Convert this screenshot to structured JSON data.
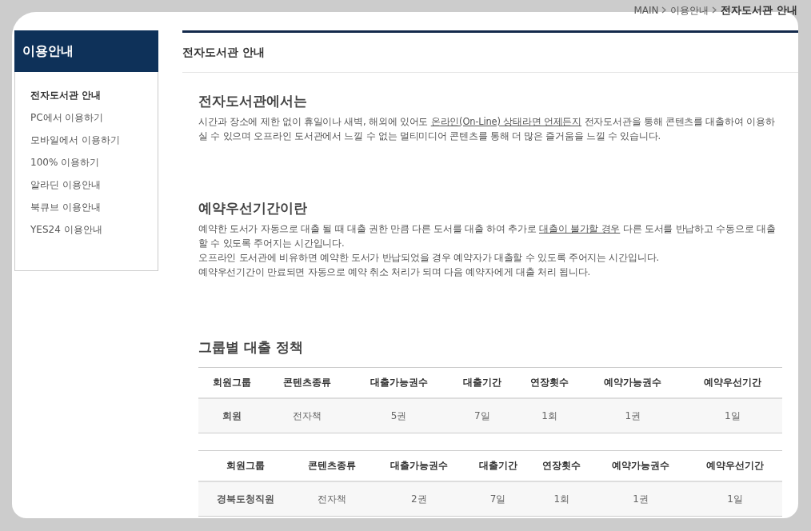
{
  "breadcrumb": {
    "items": [
      "MAIN",
      "이용안내"
    ],
    "current": "전자도서관 안내"
  },
  "sidebar": {
    "title": "이용안내",
    "items": [
      {
        "label": "전자도서관 안내",
        "selected": true
      },
      {
        "label": "PC에서 이용하기",
        "selected": false
      },
      {
        "label": "모바일에서 이용하기",
        "selected": false
      },
      {
        "label": "100% 이용하기",
        "selected": false
      },
      {
        "label": "알라딘 이용안내",
        "selected": false
      },
      {
        "label": "북큐브 이용안내",
        "selected": false
      },
      {
        "label": "YES24 이용안내",
        "selected": false
      }
    ]
  },
  "page_title": "전자도서관 안내",
  "sections": [
    {
      "heading": "전자도서관에서는",
      "paragraphs": [
        [
          {
            "kind": "text",
            "text": "시간과 장소에 제한 없이 휴일이나 새벽, 해외에 있어도 "
          },
          {
            "kind": "link",
            "text": "온라인(On-Line) 상태라면 언제든지"
          },
          {
            "kind": "text",
            "text": " 전자도서관을 통해 콘텐츠를 대출하여 이용하실 수 있으며 오프라인 도서관에서 느낄 수 없는 멀티미디어 콘텐츠를 통해 더 많은 즐거움을 느낄 수 있습니다."
          }
        ]
      ]
    },
    {
      "heading": "예약우선기간이란",
      "paragraphs": [
        [
          {
            "kind": "text",
            "text": "예약한 도서가 자동으로 대출 될 때 대출 권한 만큼 다른 도서를 대출 하여 추가로 "
          },
          {
            "kind": "link",
            "text": "대출이 불가할 경우"
          },
          {
            "kind": "text",
            "text": " 다른 도서를 반납하고 수동으로 대출 할 수 있도록 주어지는 시간입니다."
          }
        ],
        [
          {
            "kind": "text",
            "text": "오프라인 도서관에 비유하면 예약한 도서가 반납되었을 경우 예약자가 대출할 수 있도록 주어지는 시간입니다."
          }
        ],
        [
          {
            "kind": "text",
            "text": "예약우선기간이 만료되면 자동으로 예약 취소 처리가 되며 다음 예약자에게 대출 처리 됩니다."
          }
        ]
      ]
    },
    {
      "heading": "그룹별 대출 정책",
      "tables": [
        {
          "columns": [
            "회원그룹",
            "콘텐츠종류",
            "대출가능권수",
            "대출기간",
            "연장횟수",
            "예약가능권수",
            "예약우선기간"
          ],
          "rows": [
            [
              "회원",
              "전자책",
              "5권",
              "7일",
              "1회",
              "1권",
              "1일"
            ]
          ]
        },
        {
          "columns": [
            "회원그룹",
            "콘텐츠종류",
            "대출가능권수",
            "대출기간",
            "연장횟수",
            "예약가능권수",
            "예약우선기간"
          ],
          "rows": [
            [
              "경북도청직원",
              "전자책",
              "2권",
              "7일",
              "1회",
              "1권",
              "1일"
            ]
          ]
        }
      ]
    }
  ]
}
